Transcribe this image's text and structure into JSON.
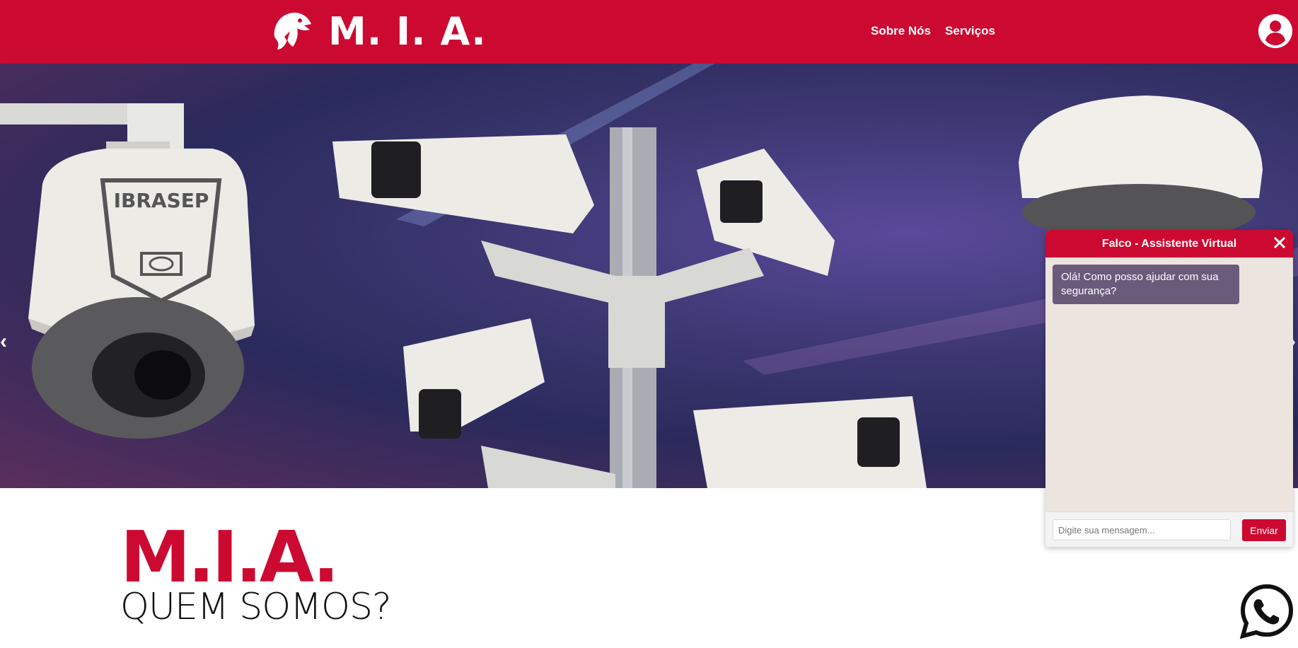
{
  "header": {
    "logo_text": "M. I. A.",
    "nav": [
      {
        "label": "Sobre Nós"
      },
      {
        "label": "Serviços"
      }
    ],
    "avatar_icon": "user-circle-icon"
  },
  "hero": {
    "prev_arrow": "‹",
    "next_arrow": "›",
    "camera_badge": "IBRASEP"
  },
  "about": {
    "brand": "M.I.A.",
    "subtitle": "QUEM SOMOS?"
  },
  "chat": {
    "title": "Falco - Assistente Virtual",
    "close_icon": "close-icon",
    "messages": [
      {
        "sender": "bot",
        "text": "Olá! Como posso ajudar com sua segurança?"
      }
    ],
    "input_placeholder": "Digite sua mensagem...",
    "send_label": "Enviar"
  },
  "whatsapp": {
    "icon": "whatsapp-icon"
  },
  "colors": {
    "brand_red": "#cc0a31",
    "chat_bubble": "#6b5b7b",
    "chat_bg": "#ece5df"
  }
}
